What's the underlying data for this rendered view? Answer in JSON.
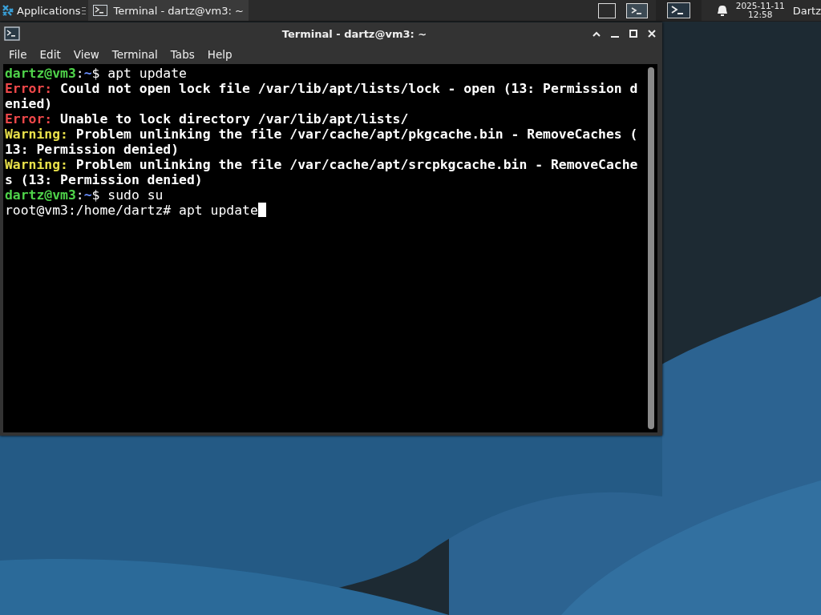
{
  "panel": {
    "applications_label": "Applications",
    "taskbar_items": [
      {
        "label": "Terminal - dartz@vm3: ~",
        "selected": true
      }
    ],
    "workspaces": [
      {
        "selected": false
      },
      {
        "selected": true
      }
    ],
    "clock_date": "2025-11-11",
    "clock_time": "12:58",
    "user": "Dartz"
  },
  "window": {
    "title": "Terminal - dartz@vm3: ~",
    "menu": [
      "File",
      "Edit",
      "View",
      "Terminal",
      "Tabs",
      "Help"
    ],
    "lines": [
      {
        "cursor": false,
        "segments": [
          {
            "kind": "user",
            "text": "dartz@vm3"
          },
          {
            "kind": "plain",
            "text": ":"
          },
          {
            "kind": "path",
            "text": "~"
          },
          {
            "kind": "plain",
            "text": "$ apt update"
          }
        ]
      },
      {
        "cursor": false,
        "segments": [
          {
            "kind": "error",
            "text": "Error:"
          },
          {
            "kind": "bold",
            "text": " Could not open lock file /var/lib/apt/lists/lock - open (13: Permission d"
          }
        ]
      },
      {
        "cursor": false,
        "segments": [
          {
            "kind": "bold",
            "text": "enied)"
          }
        ]
      },
      {
        "cursor": false,
        "segments": [
          {
            "kind": "error",
            "text": "Error:"
          },
          {
            "kind": "bold",
            "text": " Unable to lock directory /var/lib/apt/lists/"
          }
        ]
      },
      {
        "cursor": false,
        "segments": [
          {
            "kind": "warning",
            "text": "Warning:"
          },
          {
            "kind": "bold",
            "text": " Problem unlinking the file /var/cache/apt/pkgcache.bin - RemoveCaches ("
          }
        ]
      },
      {
        "cursor": false,
        "segments": [
          {
            "kind": "bold",
            "text": "13: Permission denied)"
          }
        ]
      },
      {
        "cursor": false,
        "segments": [
          {
            "kind": "warning",
            "text": "Warning:"
          },
          {
            "kind": "bold",
            "text": " Problem unlinking the file /var/cache/apt/srcpkgcache.bin - RemoveCache"
          }
        ]
      },
      {
        "cursor": false,
        "segments": [
          {
            "kind": "bold",
            "text": "s (13: Permission denied)"
          }
        ]
      },
      {
        "cursor": false,
        "segments": [
          {
            "kind": "user",
            "text": "dartz@vm3"
          },
          {
            "kind": "plain",
            "text": ":"
          },
          {
            "kind": "path",
            "text": "~"
          },
          {
            "kind": "plain",
            "text": "$ sudo su"
          }
        ]
      },
      {
        "cursor": true,
        "segments": [
          {
            "kind": "plain",
            "text": "root@vm3:/home/dartz# apt update"
          }
        ]
      }
    ]
  }
}
